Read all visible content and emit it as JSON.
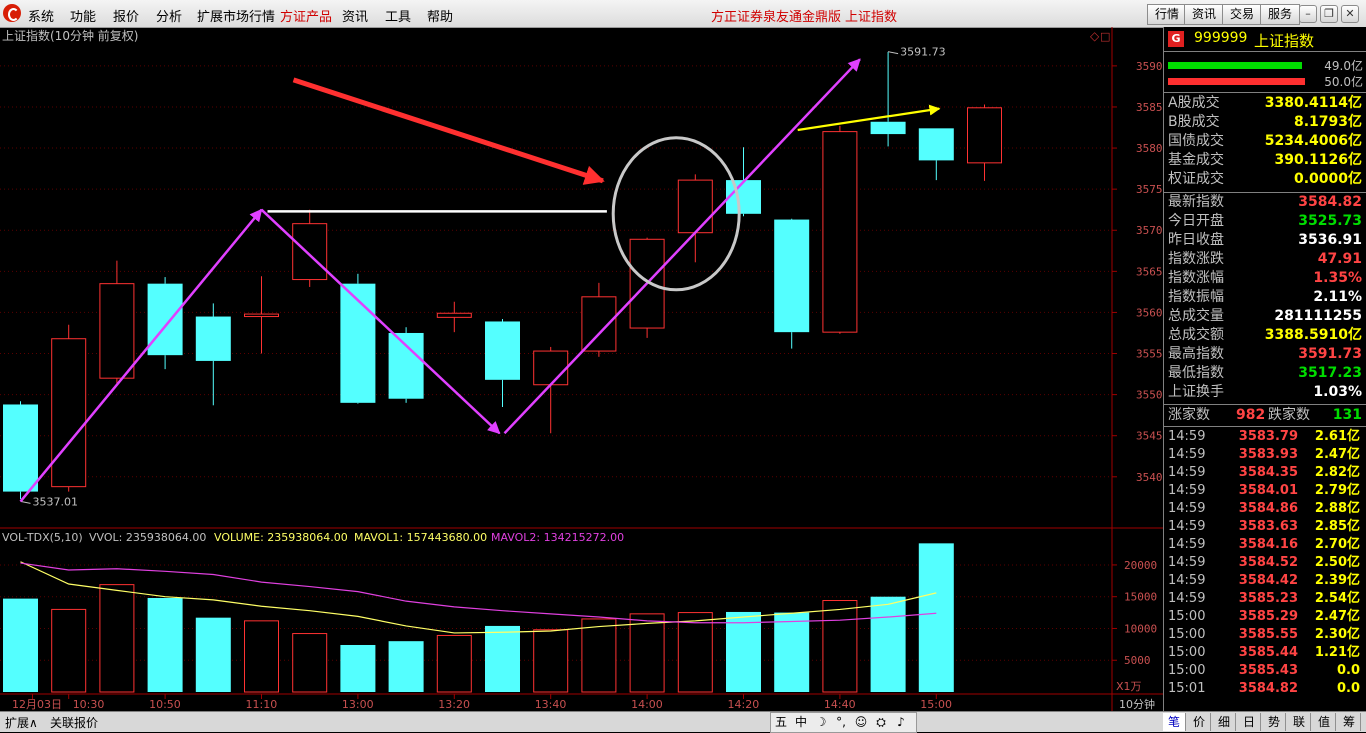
{
  "menu": {
    "items": [
      "系统",
      "功能",
      "报价",
      "分析",
      "扩展市场行情",
      "方证产品",
      "资讯",
      "工具",
      "帮助"
    ],
    "highlight_index": 5,
    "center_title": "方正证券泉友通金鼎版",
    "center_subtitle": "上证指数",
    "right_buttons": [
      "行情",
      "资讯",
      "交易",
      "服务"
    ]
  },
  "chart": {
    "title": "上证指数(10分钟 前复权)",
    "max_label": "3591.73",
    "min_label": "3537.01",
    "price_axis_labels": [
      "3590",
      "3585",
      "3580",
      "3575",
      "3570",
      "3565",
      "3560",
      "3555",
      "3550",
      "3545",
      "3540"
    ],
    "vol_header": {
      "indicator": "VOL-TDX(5,10)",
      "vvol": "VVOL: 235938064.00",
      "volume": "VOLUME: 235938064.00",
      "mavol1": "MAVOL1: 157443680.00",
      "mavol2": "MAVOL2: 134215272.00"
    },
    "vol_axis_labels": [
      "20000",
      "15000",
      "10000",
      "5000"
    ],
    "vol_unit": "X1万",
    "time_labels": [
      "12月03日",
      "10:30",
      "10:50",
      "11:10",
      "13:00",
      "13:20",
      "13:40",
      "14:00",
      "14:20",
      "14:40",
      "15:00"
    ],
    "period": "10分钟",
    "colors": {
      "up": "#ff3232",
      "down": "#54ffff",
      "ma1": "#ffff66",
      "ma2": "#e040e0",
      "annot_arrow": "#ff3030",
      "annot_line": "#e040ff",
      "annot_yellow": "#ffff00",
      "annot_white": "#ffffff"
    }
  },
  "chart_data": {
    "type": "candlestick",
    "title": "上证指数(10分钟 前复权)",
    "x": [
      "10:10",
      "10:20",
      "10:30",
      "10:40",
      "10:50",
      "11:00",
      "11:10",
      "11:20",
      "11:30",
      "13:10",
      "13:20",
      "13:30",
      "13:40",
      "13:50",
      "14:00",
      "14:10",
      "14:20",
      "14:30",
      "14:40",
      "14:50",
      "15:00"
    ],
    "open": [
      3548.8,
      3538.8,
      3552.0,
      3563.5,
      3559.5,
      3559.5,
      3564.0,
      3563.5,
      3557.5,
      3559.4,
      3558.9,
      3551.2,
      3555.3,
      3558.1,
      3569.7,
      3576.1,
      3571.3,
      3557.6,
      3583.2,
      3582.4,
      3578.2
    ],
    "close": [
      3538.2,
      3556.8,
      3563.5,
      3554.8,
      3554.1,
      3559.8,
      3570.8,
      3549.0,
      3549.5,
      3559.9,
      3551.8,
      3555.3,
      3561.9,
      3568.9,
      3576.1,
      3572.0,
      3557.6,
      3582.0,
      3581.7,
      3578.5,
      3584.9
    ],
    "high": [
      3549.2,
      3558.5,
      3566.3,
      3564.3,
      3561.1,
      3564.4,
      3572.5,
      3564.7,
      3558.2,
      3561.3,
      3559.2,
      3555.8,
      3563.6,
      3569.1,
      3576.8,
      3580.1,
      3571.4,
      3582.7,
      3591.7,
      3582.4,
      3585.3
    ],
    "low": [
      3537.3,
      3538.2,
      3551.4,
      3553.1,
      3548.7,
      3555.0,
      3563.1,
      3548.9,
      3549.0,
      3557.6,
      3548.5,
      3545.3,
      3554.6,
      3556.9,
      3566.1,
      3571.7,
      3555.6,
      3557.4,
      3580.2,
      3576.1,
      3576.0
    ],
    "volume": [
      14700,
      13000,
      16900,
      14800,
      11700,
      11200,
      9200,
      7400,
      8000,
      8900,
      10400,
      9800,
      11500,
      12300,
      12500,
      12600,
      12500,
      14400,
      15000,
      23400,
      0
    ],
    "mavol1": [
      20500,
      17000,
      16000,
      15000,
      14500,
      13500,
      12800,
      11900,
      10400,
      9300,
      9400,
      9600,
      10300,
      10800,
      11200,
      11800,
      12400,
      13000,
      13800,
      15600,
      null
    ],
    "mavol2": [
      20300,
      19200,
      19400,
      19000,
      18500,
      17300,
      16600,
      15800,
      14300,
      13400,
      12800,
      12300,
      11800,
      11200,
      10900,
      10900,
      11100,
      11300,
      11800,
      12400,
      null
    ],
    "ylim": [
      3534.5,
      3594.0
    ],
    "vol_ylim": [
      0,
      25500
    ],
    "max_price": 3591.73,
    "min_price": 3537.01
  },
  "panel": {
    "code": "999999",
    "name": "上证指数",
    "buy_volume": "49.0亿",
    "sell_volume": "50.0亿",
    "stats": [
      {
        "k": "A股成交",
        "v": "3380.4114亿",
        "c": "yellow"
      },
      {
        "k": "B股成交",
        "v": "8.1793亿",
        "c": "yellow"
      },
      {
        "k": "国债成交",
        "v": "5234.4006亿",
        "c": "yellow"
      },
      {
        "k": "基金成交",
        "v": "390.1126亿",
        "c": "yellow"
      },
      {
        "k": "权证成交",
        "v": "0.0000亿",
        "c": "yellow"
      }
    ],
    "quotes": [
      {
        "k": "最新指数",
        "v": "3584.82",
        "c": "red"
      },
      {
        "k": "今日开盘",
        "v": "3525.73",
        "c": "green"
      },
      {
        "k": "昨日收盘",
        "v": "3536.91",
        "c": "white"
      },
      {
        "k": "指数涨跌",
        "v": "47.91",
        "c": "red"
      },
      {
        "k": "指数涨幅",
        "v": "1.35%",
        "c": "red"
      },
      {
        "k": "指数振幅",
        "v": "2.11%",
        "c": "white"
      },
      {
        "k": "总成交量",
        "v": "281111255",
        "c": "white"
      },
      {
        "k": "总成交额",
        "v": "3388.5910亿",
        "c": "yellow"
      },
      {
        "k": "最高指数",
        "v": "3591.73",
        "c": "red"
      },
      {
        "k": "最低指数",
        "v": "3517.23",
        "c": "green"
      },
      {
        "k": "上证换手",
        "v": "1.03%",
        "c": "white"
      }
    ],
    "breadth": {
      "up_label": "涨家数",
      "up": "982",
      "down_label": "跌家数",
      "down": "131"
    },
    "ticks": [
      {
        "t": "14:59",
        "p": "3583.79",
        "a": "2.61亿",
        "pc": "red",
        "ac": "yellow"
      },
      {
        "t": "14:59",
        "p": "3583.93",
        "a": "2.47亿",
        "pc": "red",
        "ac": "yellow"
      },
      {
        "t": "14:59",
        "p": "3584.35",
        "a": "2.82亿",
        "pc": "red",
        "ac": "yellow"
      },
      {
        "t": "14:59",
        "p": "3584.01",
        "a": "2.79亿",
        "pc": "red",
        "ac": "yellow"
      },
      {
        "t": "14:59",
        "p": "3584.86",
        "a": "2.88亿",
        "pc": "red",
        "ac": "yellow"
      },
      {
        "t": "14:59",
        "p": "3583.63",
        "a": "2.85亿",
        "pc": "red",
        "ac": "yellow"
      },
      {
        "t": "14:59",
        "p": "3584.16",
        "a": "2.70亿",
        "pc": "red",
        "ac": "yellow"
      },
      {
        "t": "14:59",
        "p": "3584.52",
        "a": "2.50亿",
        "pc": "red",
        "ac": "yellow"
      },
      {
        "t": "14:59",
        "p": "3584.42",
        "a": "2.39亿",
        "pc": "red",
        "ac": "yellow"
      },
      {
        "t": "14:59",
        "p": "3585.23",
        "a": "2.54亿",
        "pc": "red",
        "ac": "yellow"
      },
      {
        "t": "15:00",
        "p": "3585.29",
        "a": "2.47亿",
        "pc": "red",
        "ac": "yellow"
      },
      {
        "t": "15:00",
        "p": "3585.55",
        "a": "2.30亿",
        "pc": "red",
        "ac": "yellow"
      },
      {
        "t": "15:00",
        "p": "3585.44",
        "a": "1.21亿",
        "pc": "red",
        "ac": "yellow"
      },
      {
        "t": "15:00",
        "p": "3585.43",
        "a": "0.0",
        "pc": "red",
        "ac": "yellow"
      },
      {
        "t": "15:01",
        "p": "3584.82",
        "a": "0.0",
        "pc": "red",
        "ac": "yellow"
      }
    ],
    "tabs": [
      "笔",
      "价",
      "细",
      "日",
      "势",
      "联",
      "值",
      "筹"
    ],
    "active_tab": 0
  },
  "bottom": {
    "left_tabs": [
      "扩展∧",
      "关联报价"
    ],
    "tools": [
      "五",
      "中",
      "☽",
      "°,",
      "☺",
      "⛭",
      "♪"
    ]
  }
}
